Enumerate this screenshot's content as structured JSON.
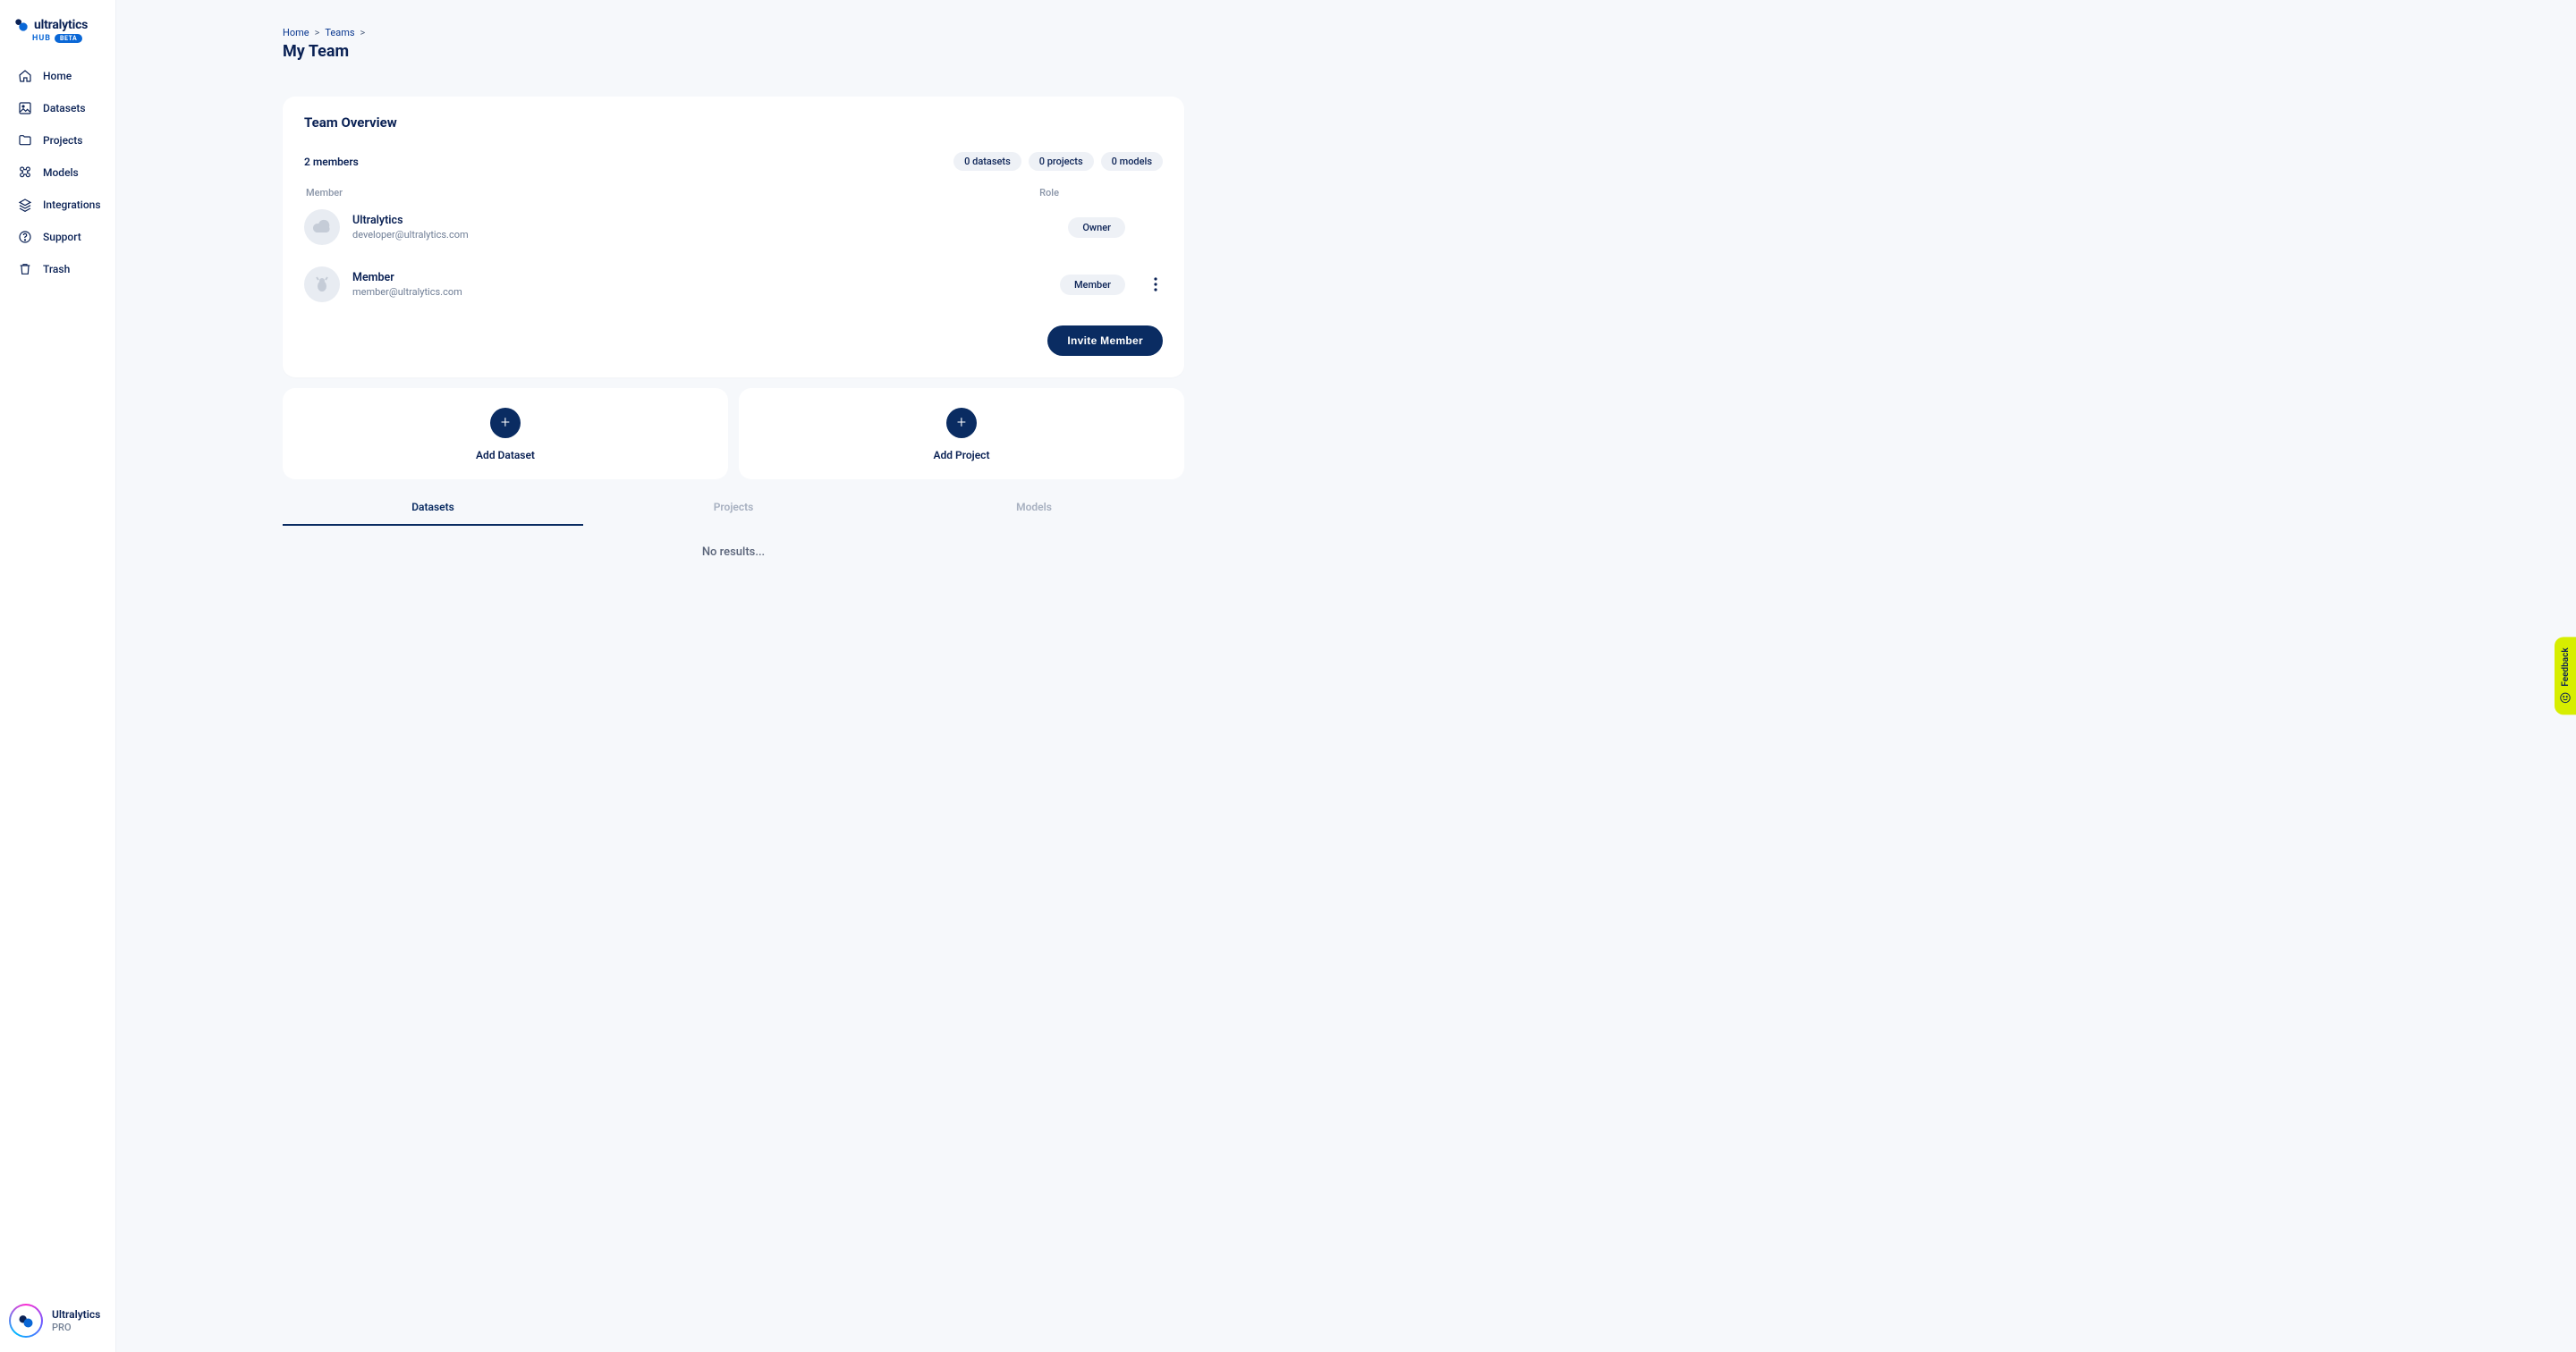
{
  "brand": {
    "name": "ultralytics",
    "hub": "HUB",
    "beta": "BETA"
  },
  "sidebar": {
    "items": [
      {
        "label": "Home",
        "icon": "home-icon"
      },
      {
        "label": "Datasets",
        "icon": "image-icon"
      },
      {
        "label": "Projects",
        "icon": "folder-icon"
      },
      {
        "label": "Models",
        "icon": "command-icon"
      },
      {
        "label": "Integrations",
        "icon": "layers-icon"
      },
      {
        "label": "Support",
        "icon": "help-icon"
      },
      {
        "label": "Trash",
        "icon": "trash-icon"
      }
    ]
  },
  "user": {
    "name": "Ultralytics",
    "plan": "PRO"
  },
  "breadcrumbs": {
    "home": "Home",
    "teams": "Teams",
    "sep": ">"
  },
  "page": {
    "title": "My Team"
  },
  "overview": {
    "title": "Team Overview",
    "member_count": "2 members",
    "stats": {
      "datasets": "0 datasets",
      "projects": "0 projects",
      "models": "0 models"
    },
    "cols": {
      "member": "Member",
      "role": "Role"
    },
    "members": [
      {
        "name": "Ultralytics",
        "email": "developer@ultralytics.com",
        "role": "Owner",
        "menu": false,
        "avatar": "cloud"
      },
      {
        "name": "Member",
        "email": "member@ultralytics.com",
        "role": "Member",
        "menu": true,
        "avatar": "bug"
      }
    ],
    "invite_label": "Invite Member"
  },
  "add": {
    "dataset": "Add Dataset",
    "project": "Add Project"
  },
  "tabs": {
    "datasets": "Datasets",
    "projects": "Projects",
    "models": "Models",
    "active": "datasets"
  },
  "results": {
    "empty": "No results..."
  },
  "feedback": {
    "label": "Feedback"
  }
}
